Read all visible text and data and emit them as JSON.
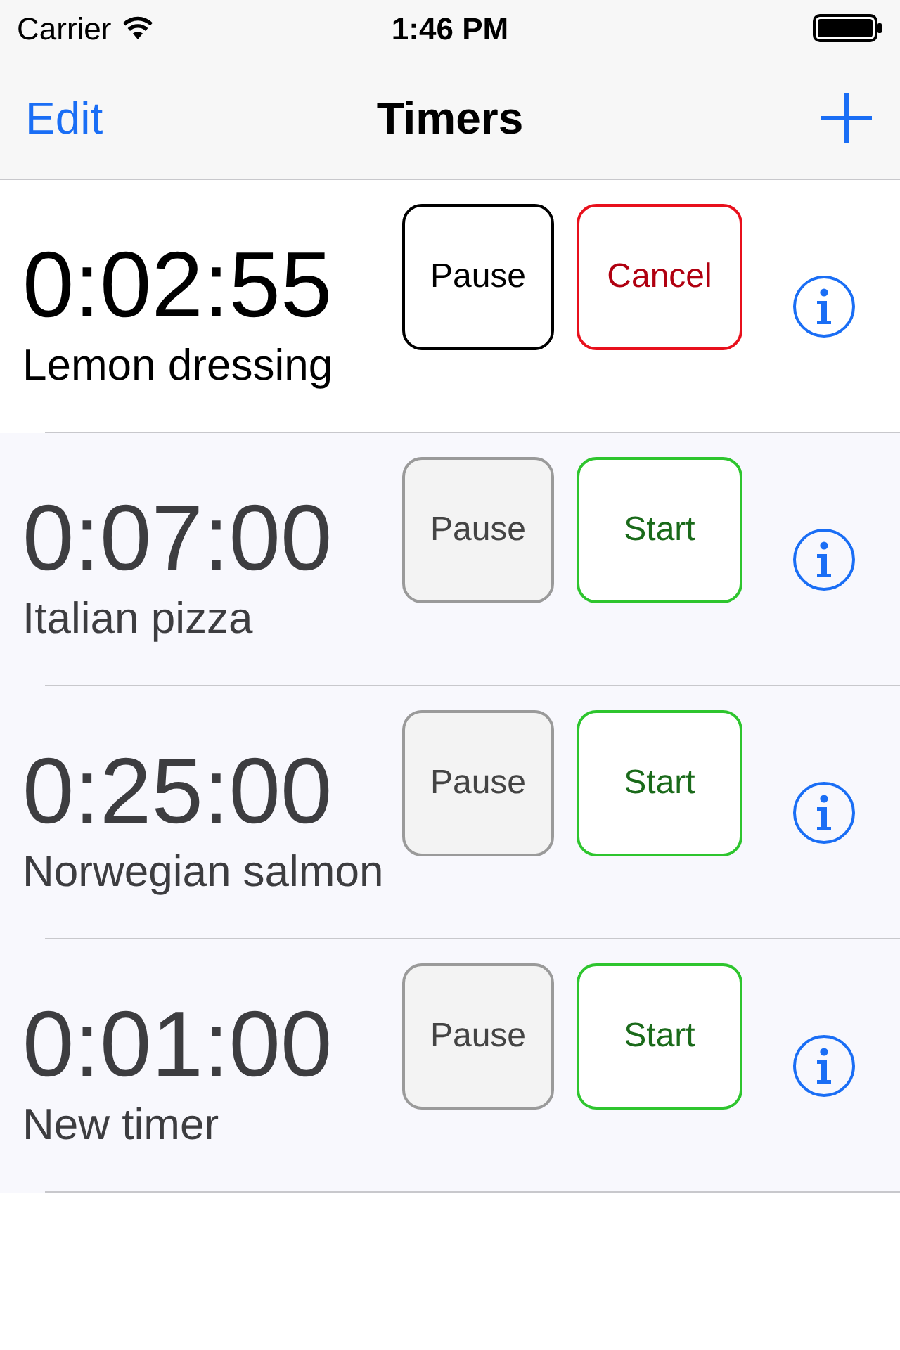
{
  "status_bar": {
    "carrier": "Carrier",
    "time": "1:46 PM"
  },
  "nav": {
    "left": "Edit",
    "title": "Timers"
  },
  "timers": [
    {
      "time": "0:02:55",
      "name": "Lemon dressing",
      "running": true,
      "pause": {
        "label": "Pause",
        "disabled": false
      },
      "action": {
        "kind": "cancel",
        "label": "Cancel"
      }
    },
    {
      "time": "0:07:00",
      "name": "Italian pizza",
      "running": false,
      "pause": {
        "label": "Pause",
        "disabled": true
      },
      "action": {
        "kind": "start",
        "label": "Start"
      }
    },
    {
      "time": "0:25:00",
      "name": "Norwegian salmon",
      "running": false,
      "pause": {
        "label": "Pause",
        "disabled": true
      },
      "action": {
        "kind": "start",
        "label": "Start"
      }
    },
    {
      "time": "0:01:00",
      "name": "New timer",
      "running": false,
      "pause": {
        "label": "Pause",
        "disabled": true
      },
      "action": {
        "kind": "start",
        "label": "Start"
      }
    }
  ]
}
